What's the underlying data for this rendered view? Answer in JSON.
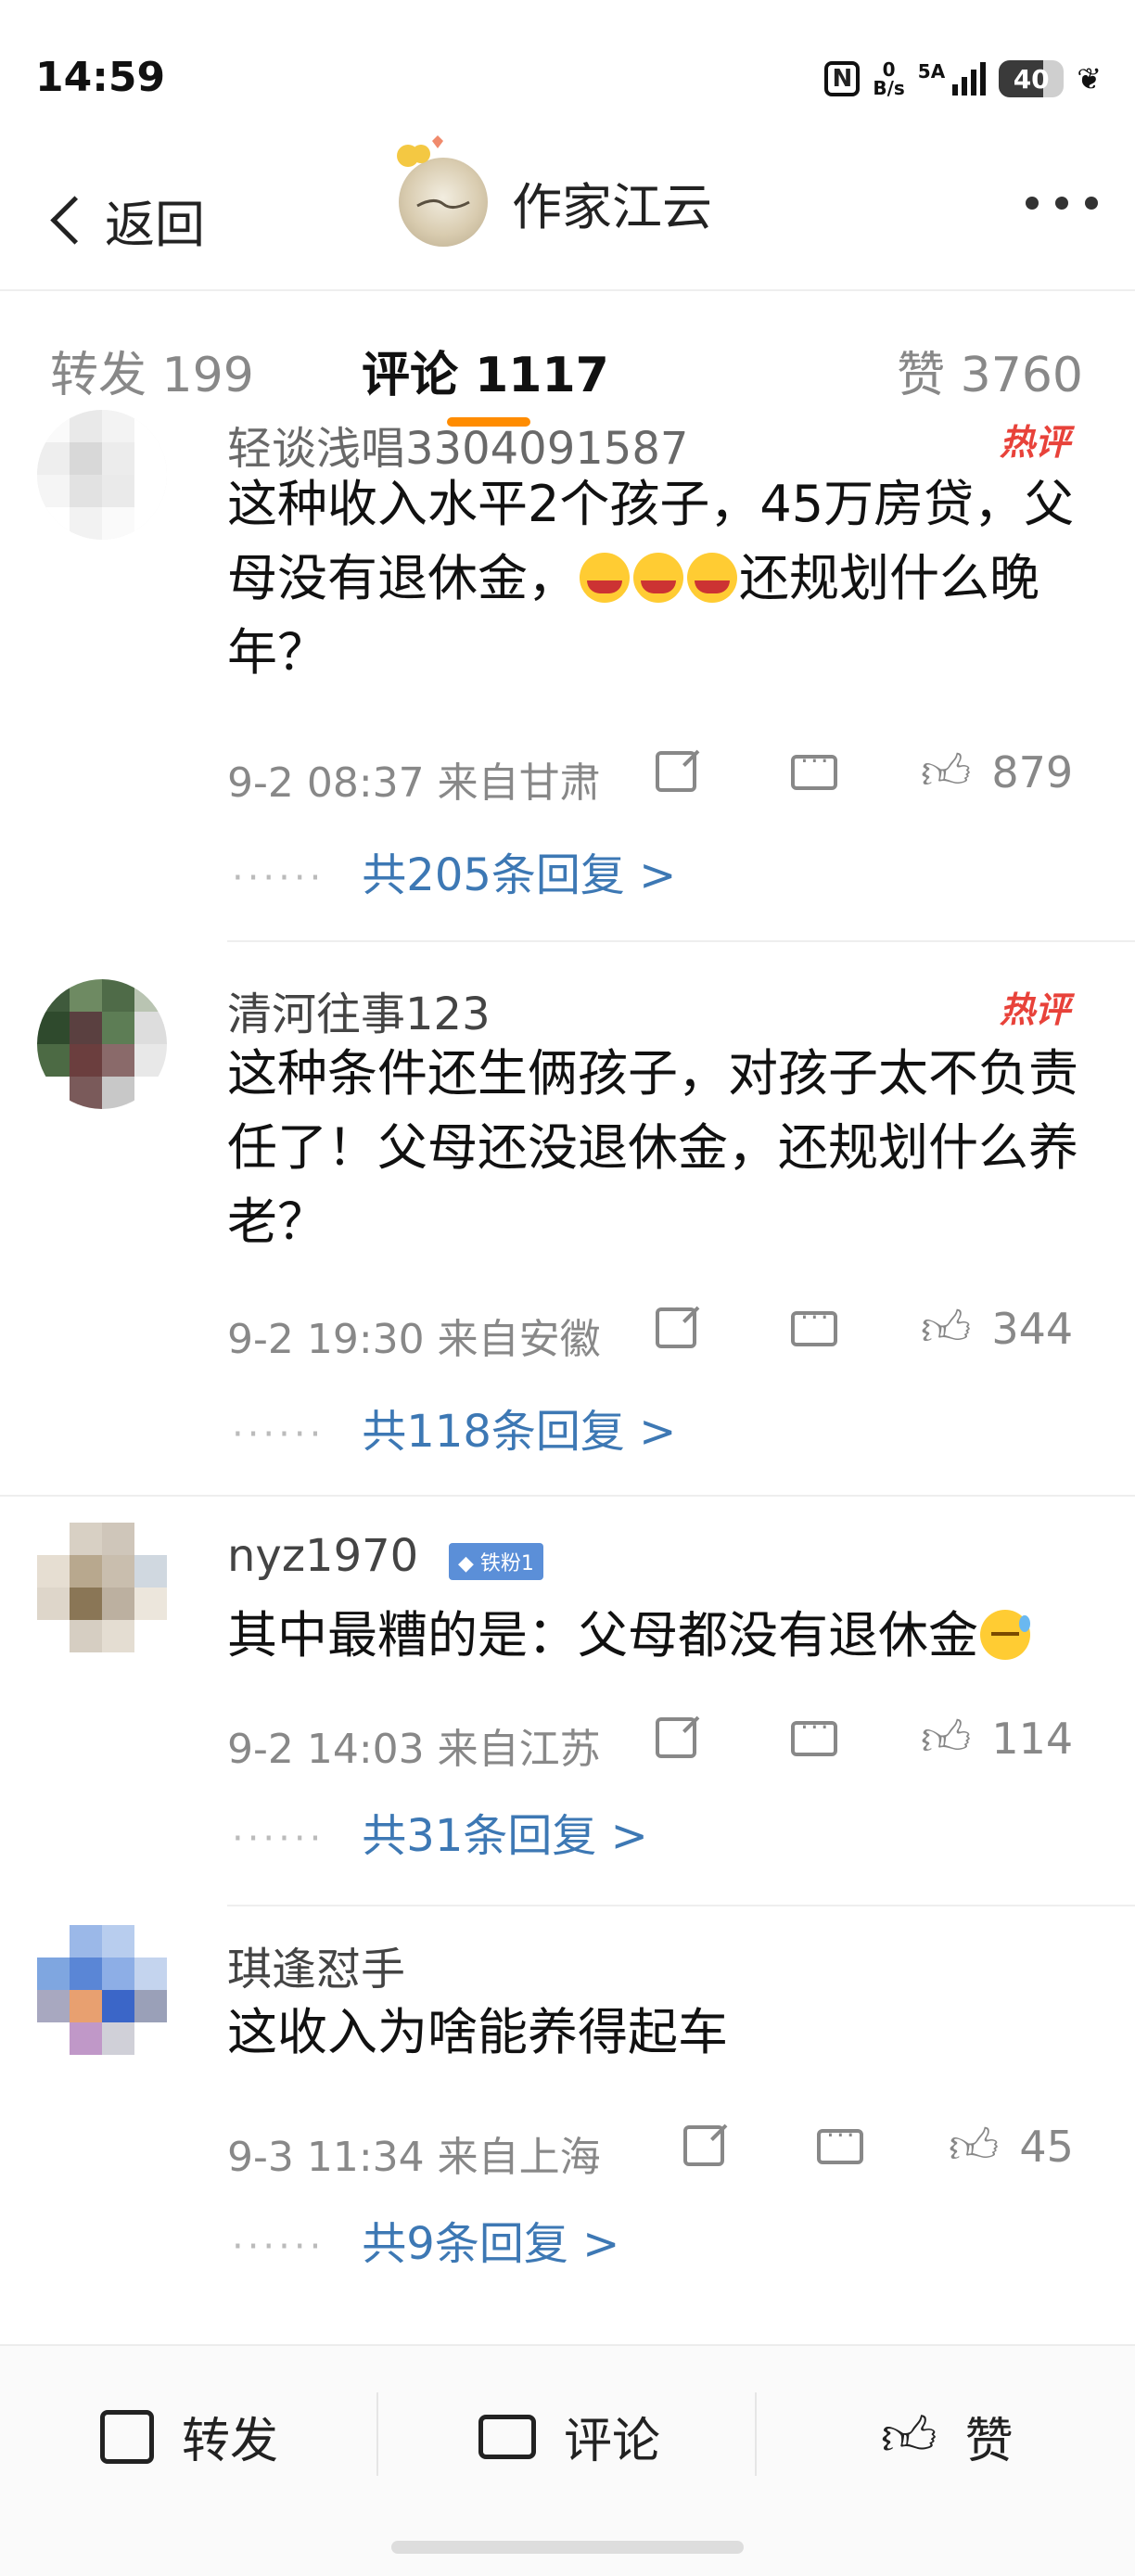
{
  "status_bar": {
    "time": "14:59",
    "network_speed_top": "0",
    "network_speed_bottom": "B/s",
    "signal_label": "5A",
    "battery": "40"
  },
  "header": {
    "back_label": "返回",
    "title": "作家江云"
  },
  "tabs": {
    "forward": "转发 199",
    "comment": "评论 1117",
    "like": "赞 3760",
    "active_color": "#ff8c00"
  },
  "comments": [
    {
      "username": "轻谈浅唱3304091587",
      "badge": "热评",
      "text_before": "这种收入水平2个孩子，45万房贷，父母没有退休金，",
      "emojis": [
        "cry",
        "cry",
        "cry"
      ],
      "text_after": "还规划什么晚年？",
      "datetime": "9-2 08:37 来自甘肃",
      "likes": "879",
      "replies": "共205条回复 >"
    },
    {
      "username": "清河往事123",
      "badge": "热评",
      "text_before": "这种条件还生俩孩子，对孩子太不负责任了！父母还没退休金，还规划什么养老？",
      "emojis": [],
      "text_after": "",
      "datetime": "9-2 19:30 来自安徽",
      "likes": "344",
      "replies": "共118条回复 >"
    },
    {
      "username": "nyz1970",
      "fan_badge": "铁粉1",
      "text_before": "其中最糟的是：父母都没有退休金",
      "emojis": [
        "sweat"
      ],
      "text_after": "",
      "datetime": "9-2 14:03 来自江苏",
      "likes": "114",
      "replies": "共31条回复 >"
    },
    {
      "username": "琪逢怼手",
      "text_before": "这收入为啥能养得起车",
      "emojis": [],
      "text_after": "",
      "datetime": "9-3 11:34 来自上海",
      "likes": "45",
      "replies": "共9条回复 >"
    }
  ],
  "bottom_bar": {
    "forward": "转发",
    "comment": "评论",
    "like": "赞"
  },
  "colors": {
    "link": "#3d78b4",
    "hot": "#e8423a",
    "accent": "#ff8c00"
  },
  "icons": [
    "share-icon",
    "comment-icon",
    "like-icon",
    "back-chevron-icon",
    "more-icon"
  ]
}
